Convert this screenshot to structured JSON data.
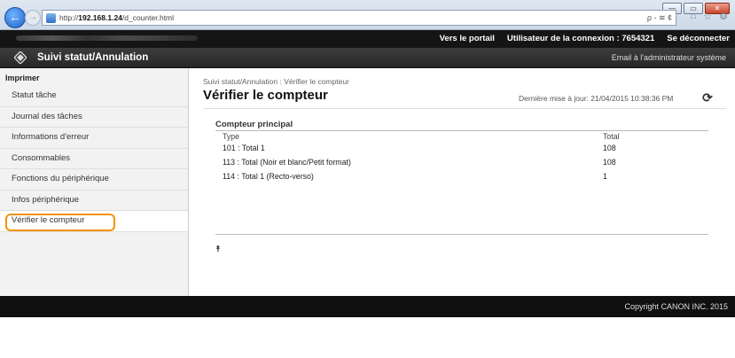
{
  "browser": {
    "url_prefix": "http://",
    "url_host": "192.168.1.24",
    "url_path": "/d_counter.html",
    "addr_tools": "ρ - ≋ ¢",
    "window_minimize": "—",
    "window_maximize": "▭",
    "window_close": "✕",
    "icon_home": "⌂",
    "icon_star": "☆",
    "icon_gear": "⚙"
  },
  "header": {
    "portal_link": "Vers le portail",
    "login_label": "Utilisateur de la connexion :",
    "login_user": "7654321",
    "logout_link": "Se déconnecter",
    "section_title": "Suivi statut/Annulation",
    "admin_mail_link": "Email à l'administrateur système"
  },
  "sidebar": {
    "heading": "Imprimer",
    "items": [
      {
        "label": "Statut tâche"
      },
      {
        "label": "Journal des tâches"
      },
      {
        "label": "Informations d'erreur"
      },
      {
        "label": "Consommables"
      },
      {
        "label": "Fonctions du périphérique"
      },
      {
        "label": "Infos périphérique"
      },
      {
        "label": "Vérifier le compteur"
      }
    ]
  },
  "main": {
    "breadcrumb": "Suivi statut/Annulation : Vérifier le compteur",
    "title": "Vérifier le compteur",
    "last_update": "Dernière mise à jour: 21/04/2015 10:38:36 PM",
    "section": "Compteur principal",
    "col_type": "Type",
    "col_total": "Total",
    "rows": [
      {
        "type": "101 : Total 1",
        "total": "108"
      },
      {
        "type": "113 : Total (Noir et blanc/Petit format)",
        "total": "108"
      },
      {
        "type": "114 : Total 1 (Recto-verso)",
        "total": "1"
      }
    ],
    "to_top": "⯭"
  },
  "footer": {
    "copyright": "Copyright CANON INC. 2015"
  }
}
